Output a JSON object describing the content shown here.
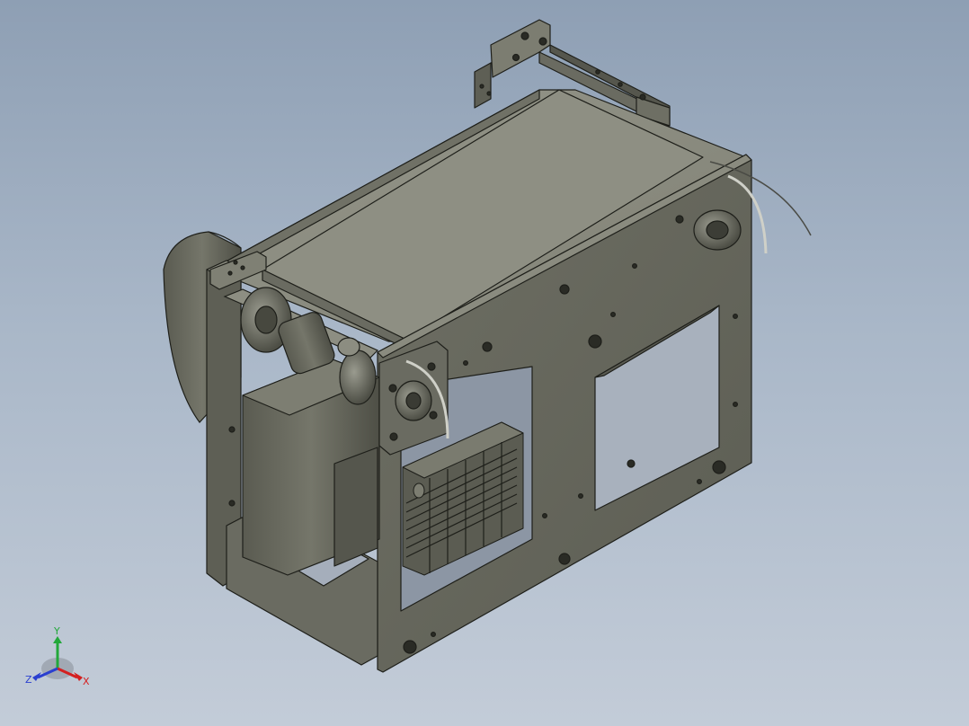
{
  "viewport": {
    "background_top": "#8e9fb4",
    "background_bottom": "#c3ccd8",
    "model_color": "#6d6e62",
    "model_color_light": "#8a8b7f",
    "edge_color": "#1e1f1a"
  },
  "triad": {
    "x_label": "X",
    "y_label": "Y",
    "z_label": "Z",
    "x_color": "#d42020",
    "y_color": "#22a83a",
    "z_color": "#2a3fd0"
  }
}
